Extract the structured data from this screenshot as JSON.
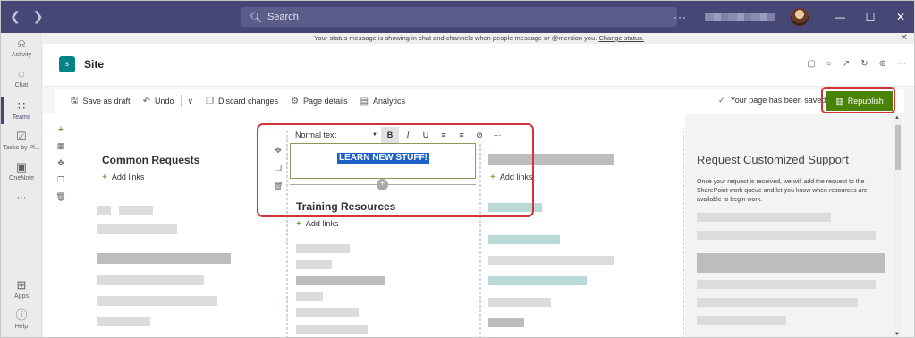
{
  "titlebar": {
    "back_icon": "chevron-left-icon",
    "forward_icon": "chevron-right-icon",
    "search_placeholder": "Search",
    "more_label": "···",
    "minimize": "—",
    "maximize": "☐",
    "close": "✕"
  },
  "rail": {
    "items": [
      {
        "label": "Activity",
        "icon": "bell-icon"
      },
      {
        "label": "Chat",
        "icon": "chat-icon"
      },
      {
        "label": "Teams",
        "icon": "teams-icon"
      },
      {
        "label": "Tasks by Pl...",
        "icon": "tasks-icon"
      },
      {
        "label": "OneNote",
        "icon": "onenote-icon"
      },
      {
        "label": "···",
        "icon": "more-icon"
      },
      {
        "label": "Apps",
        "icon": "apps-icon"
      },
      {
        "label": "Help",
        "icon": "help-icon"
      }
    ]
  },
  "notice": {
    "text": "Your status message is showing in chat and channels when people message or @mention you.",
    "link": "Change status."
  },
  "app": {
    "title": "Site",
    "logo_text": "s"
  },
  "commandbar": {
    "save_draft": "Save as draft",
    "undo": "Undo",
    "discard": "Discard changes",
    "page_details": "Page details",
    "analytics": "Analytics",
    "saved_status": "Your page has been saved",
    "republish": "Republish"
  },
  "editor": {
    "style_select": "Normal text",
    "bold": "B",
    "italic": "I",
    "underline": "U",
    "align": "≡",
    "list": "≡",
    "link": "⊘",
    "more": "···",
    "selected_text": "LEARN NEW STUFF!"
  },
  "columns": {
    "left_title": "Common Requests",
    "add_links": "Add links",
    "middle_title": "Training Resources",
    "right_panel_title": "Request Customized Support",
    "right_panel_text": "Once your request is received, we will add the request to the SharePoint work queue and let you know when resources are available to begin work."
  },
  "colors": {
    "teams_purple": "#464775",
    "republish_green": "#498205",
    "highlight_red": "#d13438"
  }
}
